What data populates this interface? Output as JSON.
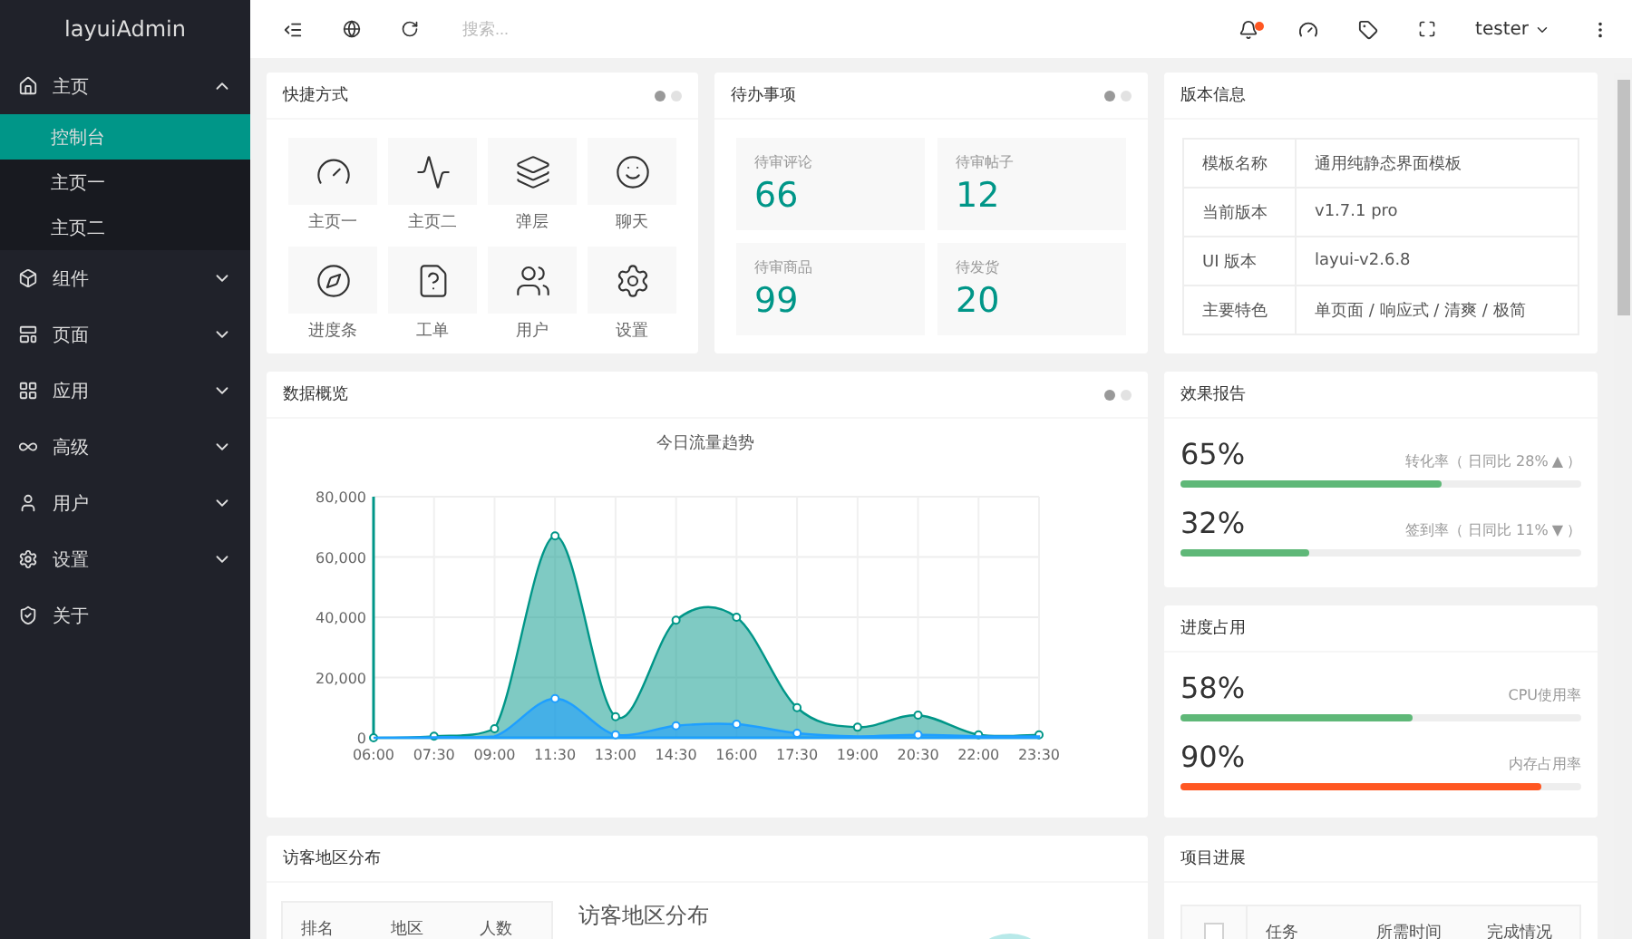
{
  "sidebar": {
    "logo": "layuiAdmin",
    "items": [
      {
        "label": "主页",
        "expanded": true,
        "children": [
          {
            "label": "控制台",
            "selected": true
          },
          {
            "label": "主页一",
            "selected": false
          },
          {
            "label": "主页二",
            "selected": false
          }
        ]
      },
      {
        "label": "组件",
        "expanded": false
      },
      {
        "label": "页面",
        "expanded": false
      },
      {
        "label": "应用",
        "expanded": false
      },
      {
        "label": "高级",
        "expanded": false
      },
      {
        "label": "用户",
        "expanded": false
      },
      {
        "label": "设置",
        "expanded": false
      },
      {
        "label": "关于"
      }
    ]
  },
  "header": {
    "search": {
      "placeholder": "搜索..."
    },
    "notification_unread": true,
    "user": "tester"
  },
  "shortcuts": {
    "title": "快捷方式",
    "pager": [
      {
        "selected": true
      },
      {
        "selected": false
      }
    ],
    "items": [
      {
        "label": "主页一"
      },
      {
        "label": "主页二"
      },
      {
        "label": "弹层"
      },
      {
        "label": "聊天"
      },
      {
        "label": "进度条"
      },
      {
        "label": "工单"
      },
      {
        "label": "用户"
      },
      {
        "label": "设置"
      }
    ]
  },
  "todo": {
    "title": "待办事项",
    "pager": [
      {
        "selected": true
      },
      {
        "selected": false
      }
    ],
    "items": [
      {
        "label": "待审评论",
        "value": "66"
      },
      {
        "label": "待审帖子",
        "value": "12"
      },
      {
        "label": "待审商品",
        "value": "99"
      },
      {
        "label": "待发货",
        "value": "20"
      }
    ]
  },
  "version": {
    "title": "版本信息",
    "rows": [
      {
        "label": "模板名称",
        "value": "通用纯静态界面模板"
      },
      {
        "label": "当前版本",
        "value": "v1.7.1 pro"
      },
      {
        "label": "UI 版本",
        "value": "layui-v2.6.8"
      },
      {
        "label": "主要特色",
        "value": "单页面 / 响应式 / 清爽 / 极简"
      }
    ]
  },
  "overview": {
    "title": "数据概览",
    "pager": [
      {
        "selected": true
      },
      {
        "selected": false
      }
    ],
    "chart_data": {
      "type": "area",
      "title": "今日流量趋势",
      "grid": true,
      "categories": [
        "06:00",
        "07:30",
        "09:00",
        "11:30",
        "13:00",
        "14:30",
        "16:00",
        "17:30",
        "19:00",
        "20:30",
        "22:00",
        "23:30"
      ],
      "series": [
        {
          "color": "#009688",
          "values": [
            0,
            500,
            3000,
            67000,
            7000,
            39000,
            40000,
            10000,
            3500,
            7500,
            1000,
            1000
          ]
        },
        {
          "color": "#1e9fff",
          "values": [
            0,
            200,
            500,
            13000,
            1000,
            4000,
            4500,
            1500,
            500,
            1000,
            500,
            500
          ]
        }
      ],
      "ylim": [
        0,
        80000
      ],
      "yticks": [
        {
          "value": 0,
          "label": "0"
        },
        {
          "value": 20000,
          "label": "20,000"
        },
        {
          "value": 40000,
          "label": "40,000"
        },
        {
          "value": 60000,
          "label": "60,000"
        },
        {
          "value": 80000,
          "label": "80,000"
        }
      ]
    }
  },
  "effect": {
    "title": "效果报告",
    "items": [
      {
        "value": "65%",
        "label": "转化率（ 日同比 28%",
        "arrow": "▲",
        "suffix": "）",
        "level": 0.65
      },
      {
        "value": "32%",
        "label": "签到率（ 日同比 11%",
        "arrow": "▼",
        "suffix": "）",
        "level": 0.32
      }
    ]
  },
  "usage": {
    "title": "进度占用",
    "items": [
      {
        "value": "58%",
        "label": "CPU使用率",
        "level": 0.58,
        "color": "#5fb878"
      },
      {
        "value": "90%",
        "label": "内存占用率",
        "level": 0.9,
        "color": "#ff5722"
      }
    ]
  },
  "visitors": {
    "title": "访客地区分布",
    "columns": [
      "排名",
      "地区",
      "人数"
    ],
    "map_title": "访客地区分布"
  },
  "project": {
    "title": "项目进展",
    "columns": [
      "任务",
      "所需时间",
      "完成情况"
    ],
    "select_all_checked": false
  }
}
